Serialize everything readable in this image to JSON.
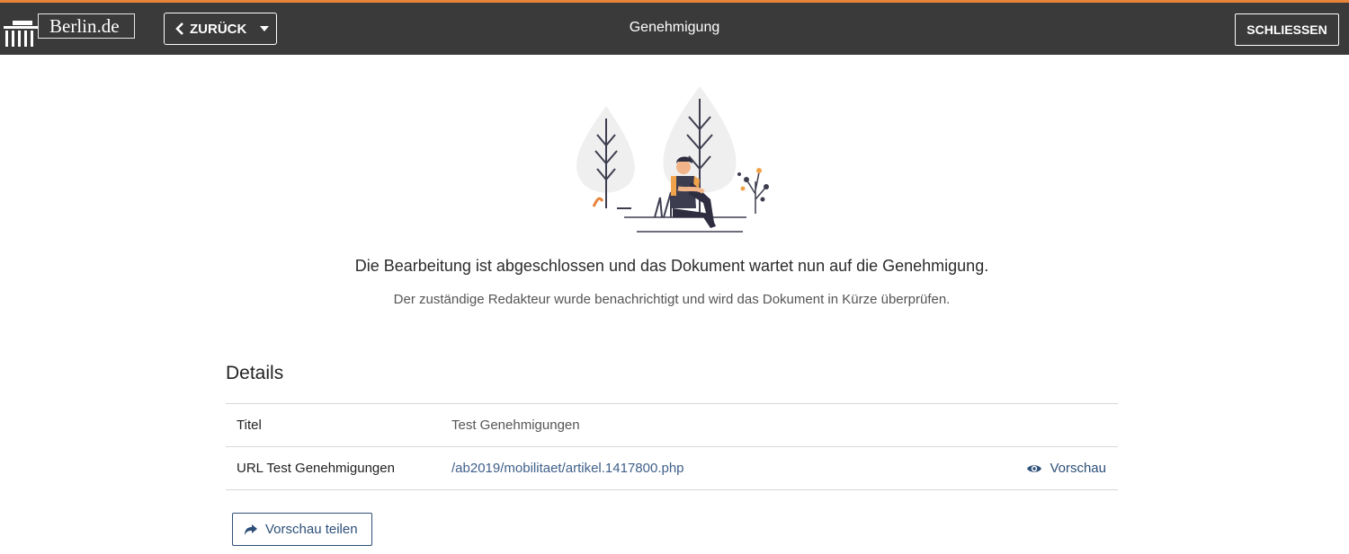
{
  "header": {
    "logo_text": "Berlin",
    "logo_suffix": ".de",
    "back_label": "ZURÜCK",
    "title": "Genehmigung",
    "close_label": "SCHLIESSEN",
    "accent_color": "#e8833a",
    "bar_color": "#3a3a3a"
  },
  "message": {
    "main": "Die Bearbeitung ist abgeschlossen und das Dokument wartet nun auf die Genehmigung.",
    "sub": "Der zuständige Redakteur wurde benachrichtigt und wird das Dokument in Kürze überprüfen."
  },
  "details": {
    "heading": "Details",
    "rows": [
      {
        "key": "Titel",
        "value": "Test Genehmigungen"
      },
      {
        "key": "URL Test Genehmigungen",
        "value": "/ab2019/mobilitaet/artikel.1417800.php",
        "action": "Vorschau"
      }
    ]
  },
  "actions": {
    "share_label": "Vorschau teilen"
  },
  "icons": {
    "back": "chevron-left-icon",
    "dropdown": "caret-down-icon",
    "preview": "eye-icon",
    "share": "share-arrow-icon"
  },
  "link_color": "#2d4f78"
}
